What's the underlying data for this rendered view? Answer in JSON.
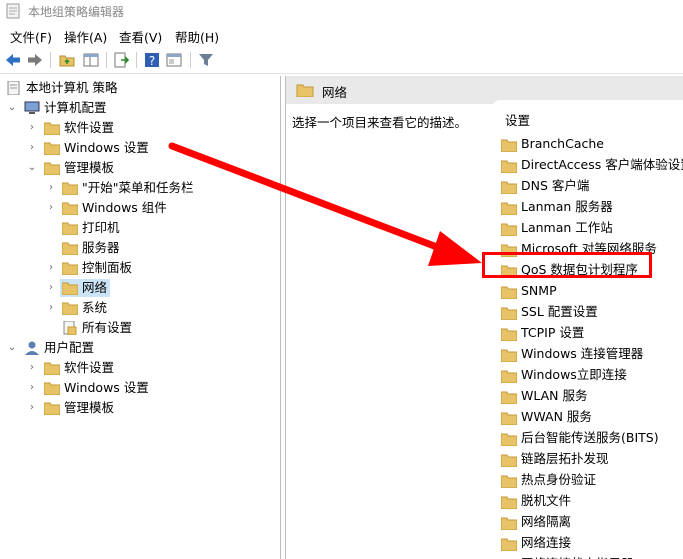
{
  "window": {
    "title": "本地组策略编辑器"
  },
  "menu": [
    {
      "label": "文件(F)"
    },
    {
      "label": "操作(A)"
    },
    {
      "label": "查看(V)"
    },
    {
      "label": "帮助(H)"
    }
  ],
  "tree": {
    "root": "本地计算机 策略",
    "computer_config": "计算机配置",
    "software_settings": "软件设置",
    "windows_settings": "Windows 设置",
    "admin_templates": "管理模板",
    "start_menu": "\"开始\"菜单和任务栏",
    "windows_components": "Windows 组件",
    "printers": "打印机",
    "servers": "服务器",
    "control_panel": "控制面板",
    "network": "网络",
    "system": "系统",
    "all_settings": "所有设置",
    "user_config": "用户配置",
    "user_software_settings": "软件设置",
    "user_windows_settings": "Windows 设置",
    "user_admin_templates": "管理模板"
  },
  "right": {
    "header_title": "网络",
    "description": "选择一个项目来查看它的描述。",
    "column_header": "设置",
    "items": [
      "BranchCache",
      "DirectAccess 客户端体验设置",
      "DNS 客户端",
      "Lanman 服务器",
      "Lanman 工作站",
      "Microsoft 对等网络服务",
      "QoS 数据包计划程序",
      "SNMP",
      "SSL 配置设置",
      "TCPIP 设置",
      "Windows 连接管理器",
      "Windows立即连接",
      "WLAN 服务",
      "WWAN 服务",
      "后台智能传送服务(BITS)",
      "链路层拓扑发现",
      "热点身份验证",
      "脱机文件",
      "网络隔离",
      "网络连接",
      "网络连接状态指示器"
    ]
  },
  "colors": {
    "annotation": "#ff0000",
    "folder": "#e8c266",
    "selection": "#cce4f7"
  }
}
